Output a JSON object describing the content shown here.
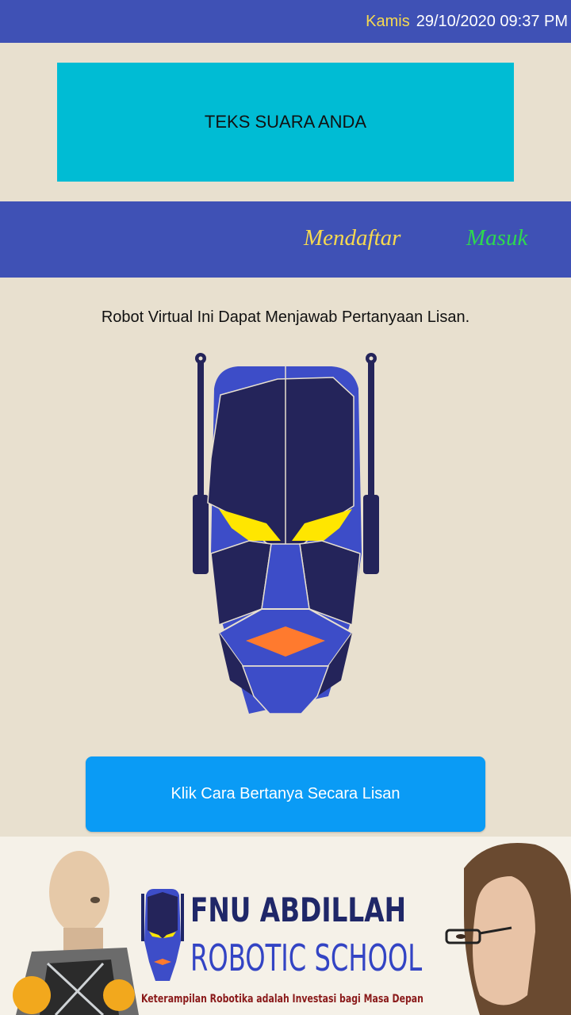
{
  "status": {
    "day": "Kamis",
    "datetime": "29/10/2020 09:37 PM"
  },
  "voice_box": {
    "text": "TEKS SUARA ANDA"
  },
  "nav": {
    "register_label": "Mendaftar",
    "login_label": "Masuk"
  },
  "description": "Robot Virtual Ini Dapat Menjawab Pertanyaan Lisan.",
  "ask_button_label": "Klik Cara Bertanya Secara Lisan",
  "banner": {
    "title": "FNU ABDILLAH",
    "subtitle": "ROBOTIC SCHOOL",
    "tagline": "Keterampilan Robotika adalah Investasi bagi Masa Depan"
  },
  "colors": {
    "bar": "#3f51b5",
    "voice_box": "#00bcd4",
    "button": "#0a9bf5",
    "background": "#e8e0cf",
    "robot_dark": "#24245a",
    "robot_blue": "#3d4dc8",
    "robot_eye": "#ffe600",
    "robot_mouth": "#ff7a2e"
  }
}
